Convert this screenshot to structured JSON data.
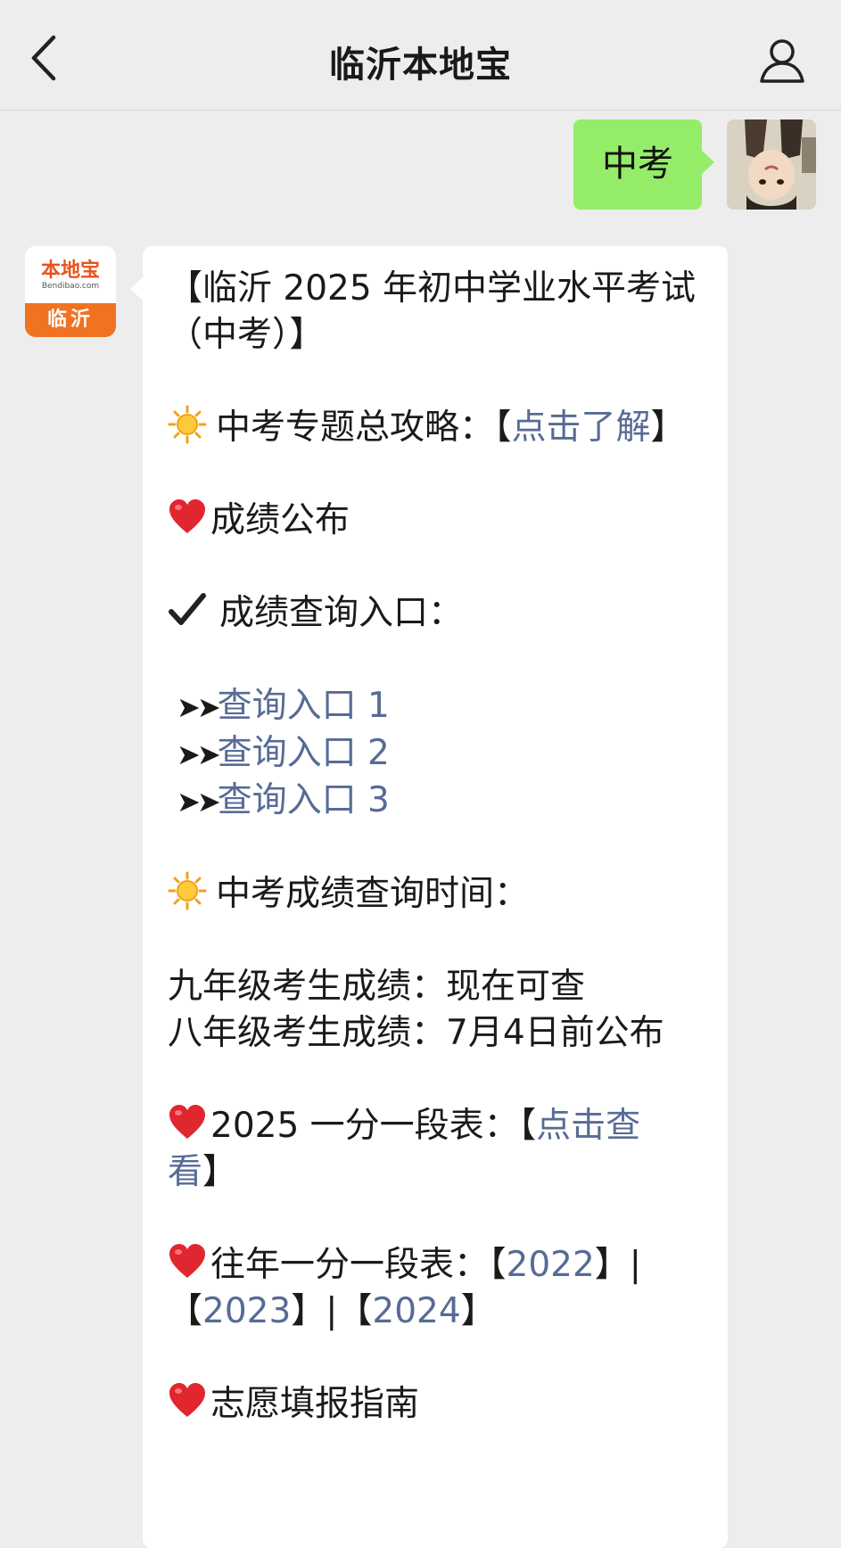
{
  "header": {
    "title": "临沂本地宝"
  },
  "user_message": {
    "text": "中考"
  },
  "bot_avatar": {
    "brand": "本地宝",
    "brand_sub": "Bendibao.com",
    "city": "临沂"
  },
  "reply": {
    "heading": "【临沂 2025 年初中学业水平考试（中考）】",
    "guide_label": "中考专题总攻略：【",
    "guide_link": "点击了解",
    "guide_close": "】",
    "score_release": "成绩公布",
    "query_entry_label": "成绩查询入口：",
    "query_links": [
      "查询入口 1",
      "查询入口 2",
      "查询入口 3"
    ],
    "arrow_glyph": "➤➤",
    "query_time_label": "中考成绩查询时间：",
    "grade9": "九年级考生成绩：现在可查",
    "grade8": "八年级考生成绩：7月4日前公布",
    "table2025_label": "2025 一分一段表：【",
    "table2025_link": "点击查看",
    "table2025_close": "】",
    "past_label": "往年一分一段表：【",
    "past_2022": "2022",
    "sep1": "】|【",
    "past_2023": "2023",
    "sep2": "】|【",
    "past_2024": "2024",
    "past_close": "】",
    "volunteer": "志愿填报指南"
  },
  "icons": {
    "back": "chevron-left-icon",
    "profile": "person-icon",
    "sun": "sun-emoji",
    "heart": "heart-emoji",
    "check": "checkmark-emoji"
  }
}
